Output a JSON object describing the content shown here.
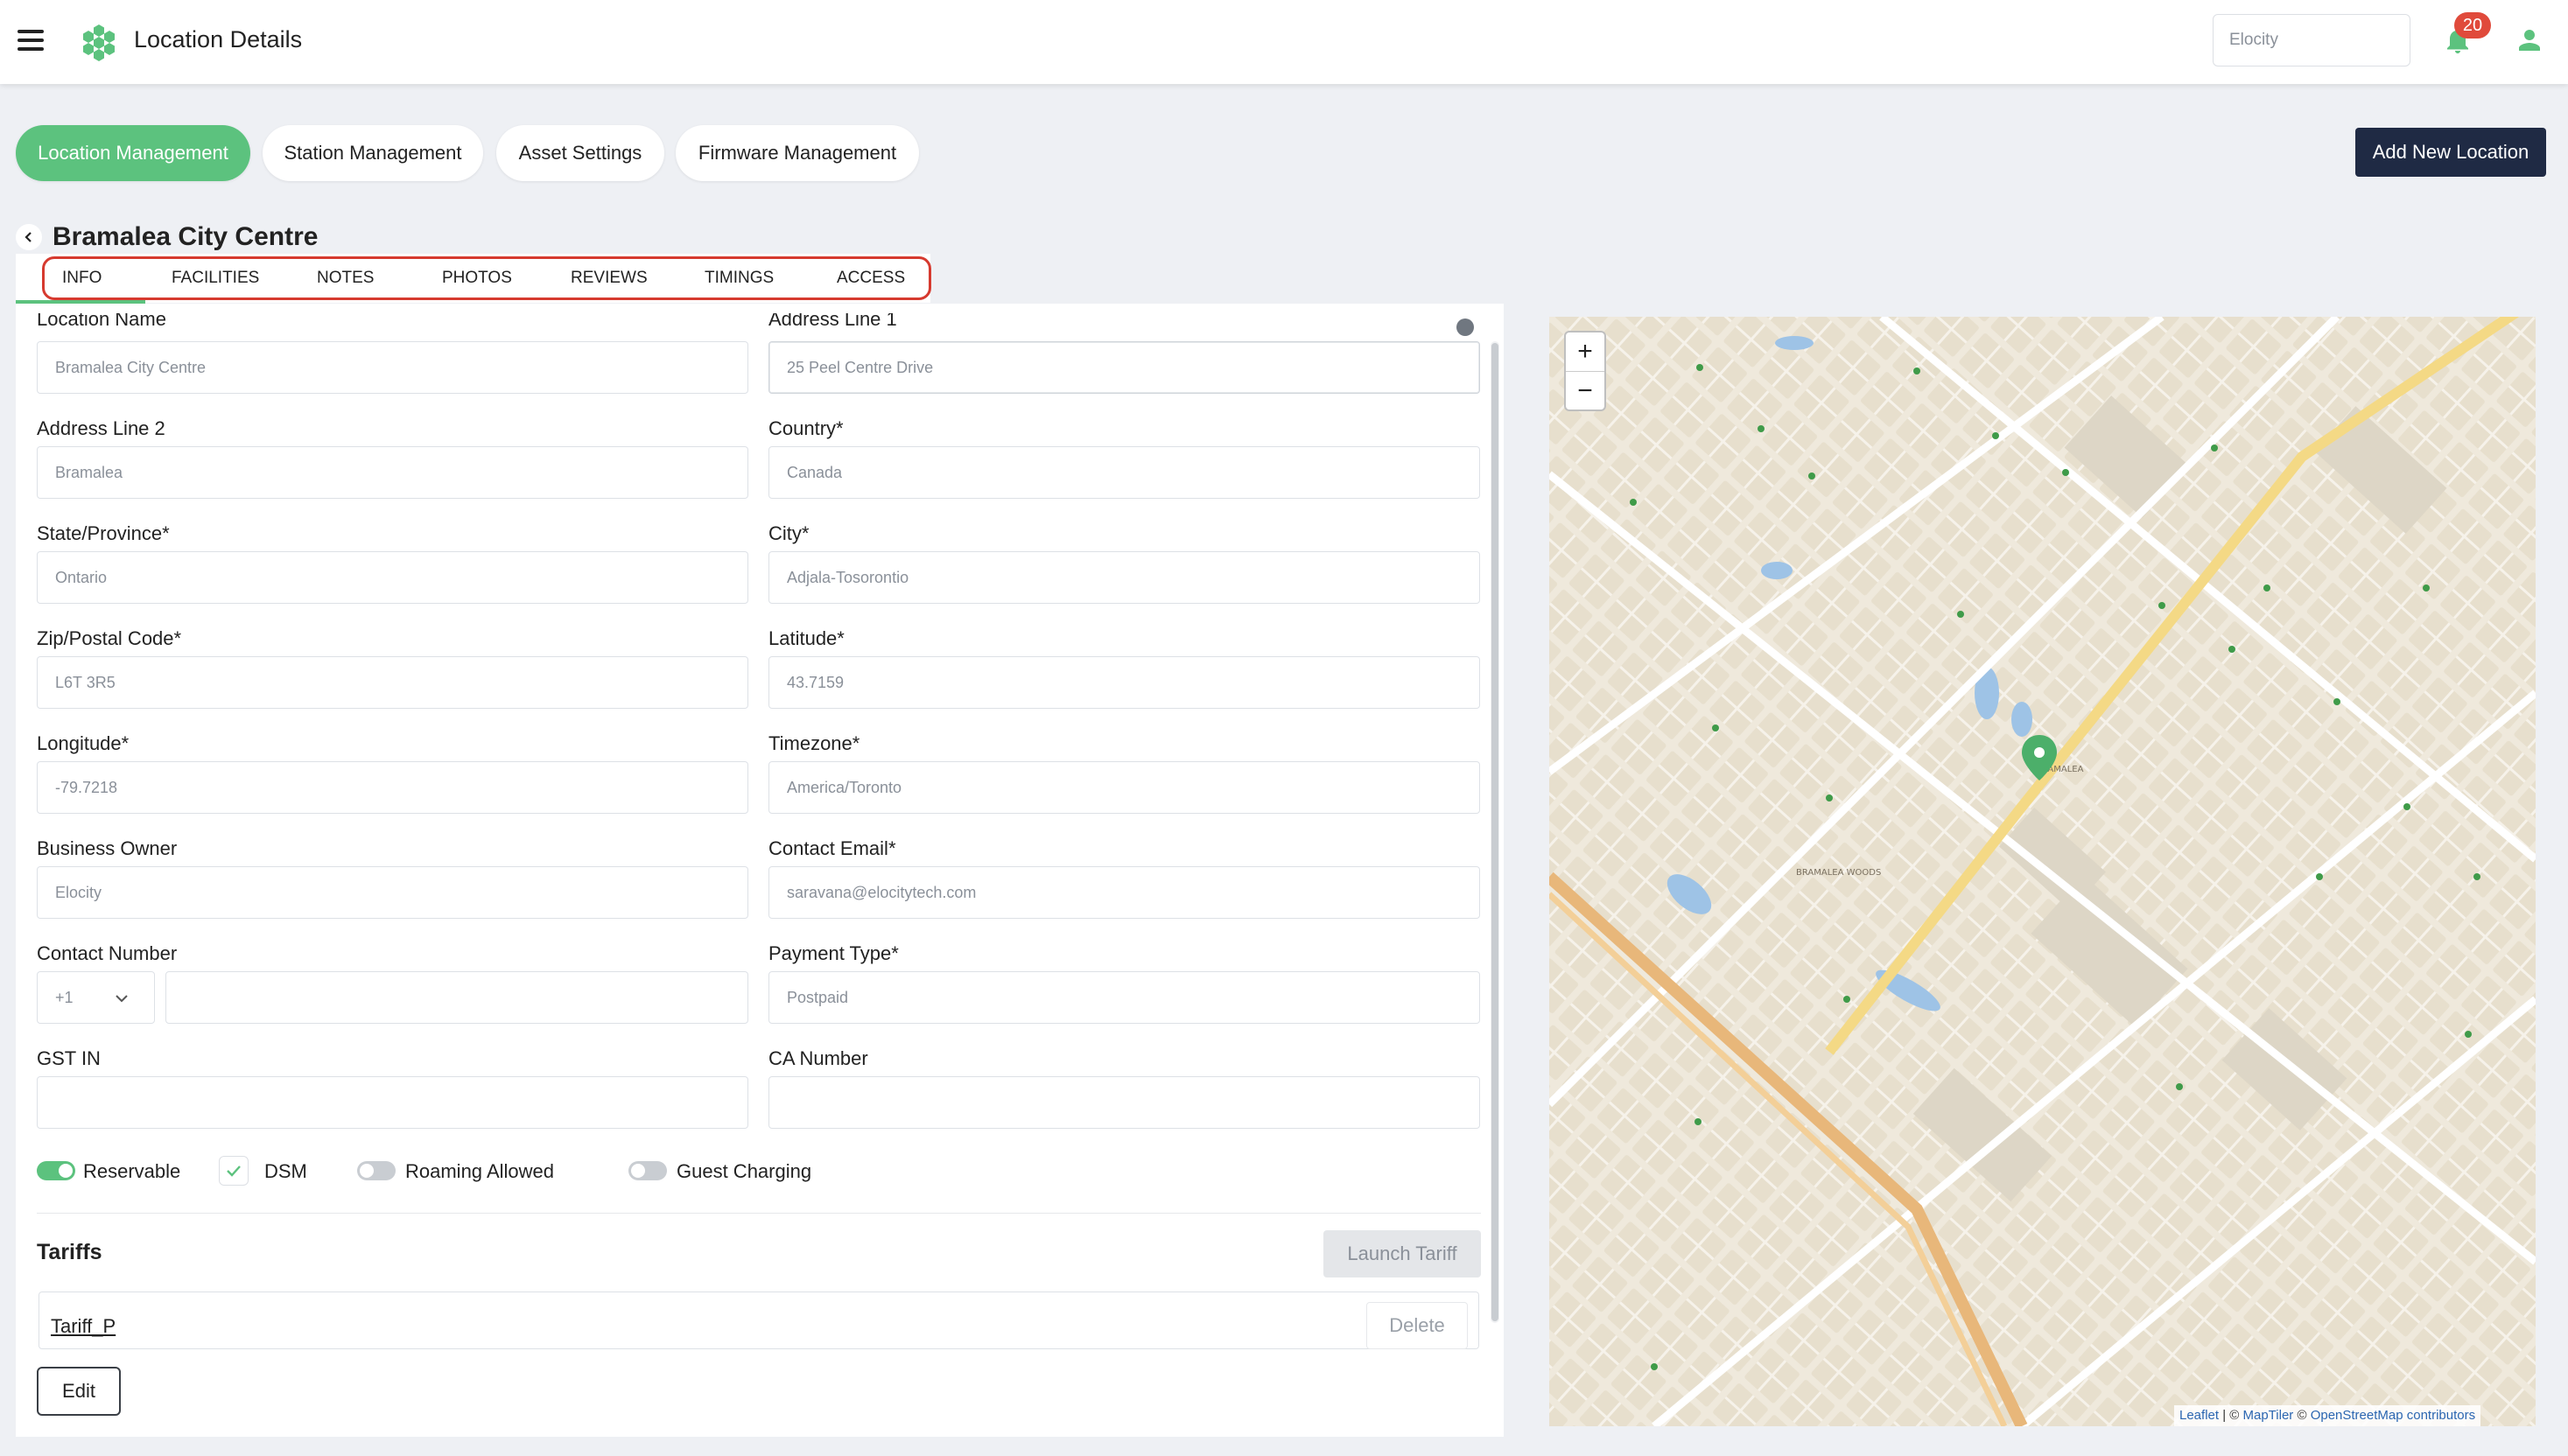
{
  "header": {
    "title": "Location Details",
    "org_value": "Elocity",
    "notification_count": "20"
  },
  "main_tabs": [
    {
      "label": "Location Management",
      "active": true
    },
    {
      "label": "Station Management",
      "active": false
    },
    {
      "label": "Asset Settings",
      "active": false
    },
    {
      "label": "Firmware Management",
      "active": false
    }
  ],
  "add_button": "Add New Location",
  "location": {
    "name": "Bramalea City Centre"
  },
  "detail_tabs": [
    "INFO",
    "FACILITIES",
    "NOTES",
    "PHOTOS",
    "REVIEWS",
    "TIMINGS",
    "ACCESS"
  ],
  "form": {
    "location_name": {
      "label": "Location Name",
      "value": "Bramalea City Centre"
    },
    "address_line_1": {
      "label": "Address Line 1",
      "value": "25 Peel Centre Drive"
    },
    "address_line_2": {
      "label": "Address Line 2",
      "value": "Bramalea"
    },
    "country": {
      "label": "Country*",
      "value": "Canada"
    },
    "state": {
      "label": "State/Province*",
      "value": "Ontario"
    },
    "city": {
      "label": "City*",
      "value": "Adjala-Tosorontio"
    },
    "zip": {
      "label": "Zip/Postal Code*",
      "value": "L6T 3R5"
    },
    "latitude": {
      "label": "Latitude*",
      "value": "43.7159"
    },
    "longitude": {
      "label": "Longitude*",
      "value": "-79.7218"
    },
    "timezone": {
      "label": "Timezone*",
      "value": "America/Toronto"
    },
    "business_owner": {
      "label": "Business Owner",
      "value": "Elocity"
    },
    "contact_email": {
      "label": "Contact Email*",
      "value": "saravana@elocitytech.com"
    },
    "contact_number": {
      "label": "Contact Number",
      "country_code": "+1",
      "value": ""
    },
    "payment_type": {
      "label": "Payment Type*",
      "value": "Postpaid"
    },
    "gst_in": {
      "label": "GST IN",
      "value": ""
    },
    "ca_number": {
      "label": "CA Number",
      "value": ""
    }
  },
  "options": {
    "reservable": {
      "label": "Reservable",
      "on": true
    },
    "dsm": {
      "label": "DSM",
      "checked": true
    },
    "roaming": {
      "label": "Roaming Allowed",
      "on": false
    },
    "guest_charging": {
      "label": "Guest Charging",
      "on": false
    }
  },
  "tariffs": {
    "title": "Tariffs",
    "launch_label": "Launch Tariff",
    "items": [
      {
        "name": "Tariff_P",
        "delete_label": "Delete"
      }
    ]
  },
  "edit_label": "Edit",
  "map": {
    "zoom_in": "+",
    "zoom_out": "−",
    "area_label": "BRAMALEA",
    "woods_label": "BRAMALEA WOODS",
    "attribution": {
      "leaflet": "Leaflet",
      "sep": " | © ",
      "maptiler": "MapTiler",
      "osm_prefix": " © ",
      "osm": "OpenStreetMap contributors"
    }
  },
  "colors": {
    "accent": "#5cc27e",
    "dark_button": "#1f2a44",
    "highlight_box": "#d63a2f",
    "badge": "#e04a3b"
  }
}
